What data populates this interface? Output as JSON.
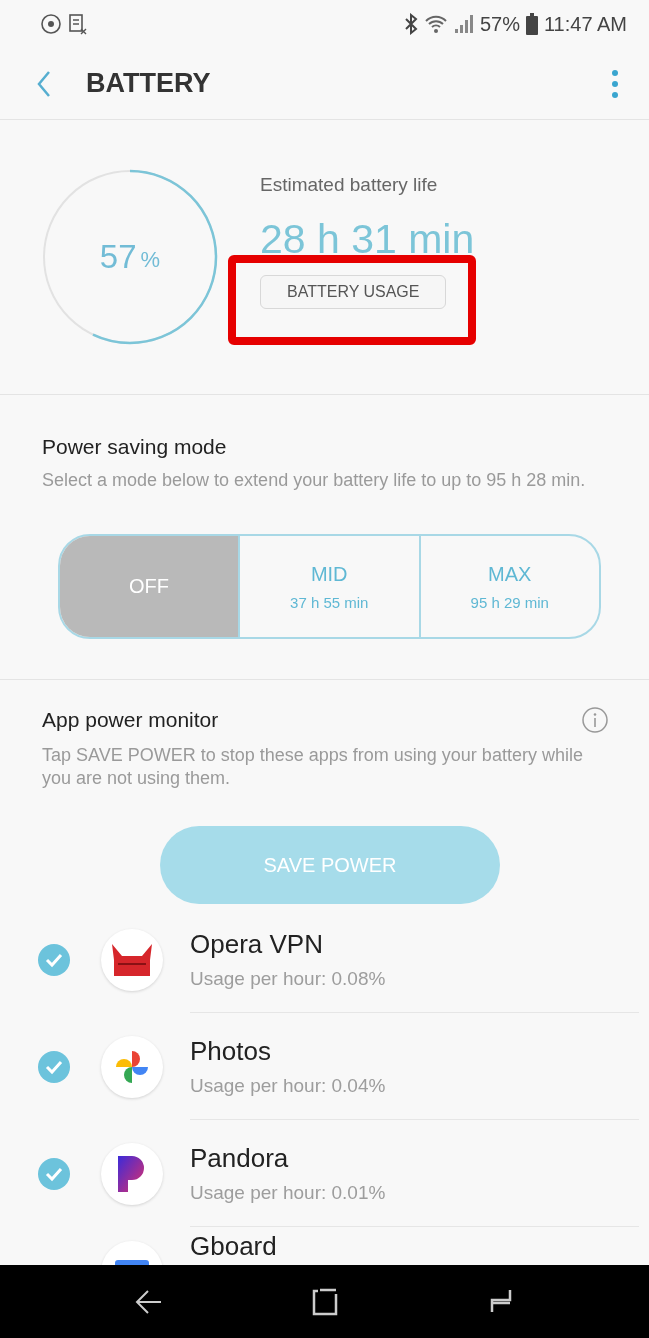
{
  "status_bar": {
    "battery": "57%",
    "time": "11:47 AM"
  },
  "header": {
    "title": "BATTERY"
  },
  "summary": {
    "percent": "57",
    "percent_unit": "%",
    "estimate_label": "Estimated battery life",
    "estimate": "28 h 31 min",
    "usage_button": "BATTERY USAGE",
    "highlighted": true
  },
  "power_saving": {
    "title": "Power saving mode",
    "description": "Select a mode below to extend your battery life to up to 95 h 28 min.",
    "modes": [
      {
        "label": "OFF",
        "selected": true
      },
      {
        "label": "MID",
        "time": "37 h 55 min",
        "selected": false
      },
      {
        "label": "MAX",
        "time": "95 h 29 min",
        "selected": false
      }
    ]
  },
  "app_monitor": {
    "title": "App power monitor",
    "description": "Tap SAVE POWER to stop these apps from using your battery while you are not using them.",
    "save_button": "SAVE POWER",
    "apps": [
      {
        "name": "Opera VPN",
        "usage": "Usage per hour: 0.08%",
        "checked": true,
        "kind": "horns"
      },
      {
        "name": "Photos",
        "usage": "Usage per hour: 0.04%",
        "checked": true,
        "kind": "pinwheel"
      },
      {
        "name": "Pandora",
        "usage": "Usage per hour: 0.01%",
        "checked": true,
        "kind": "letter"
      },
      {
        "name": "Gboard",
        "kind": "keyboard"
      }
    ]
  }
}
